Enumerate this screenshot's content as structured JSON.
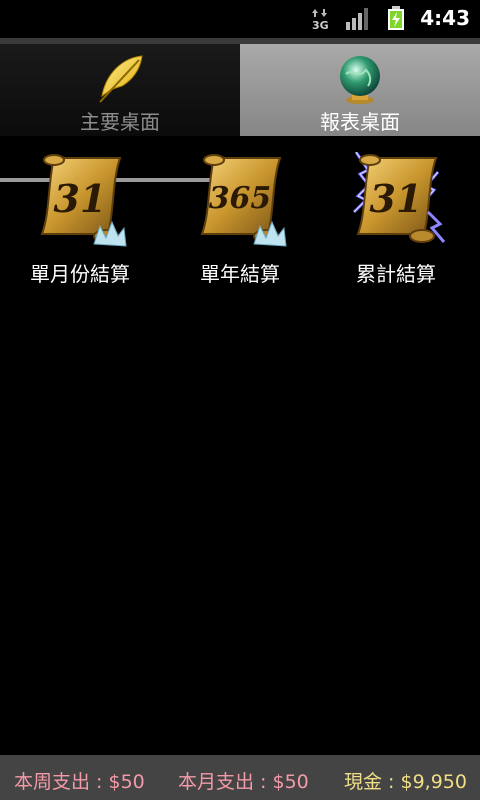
{
  "status_bar": {
    "time": "4:43",
    "icons": [
      "3g-data-icon",
      "signal-icon",
      "battery-charging-icon"
    ]
  },
  "tabs": [
    {
      "label": "主要桌面",
      "icon": "feather-quill-icon",
      "selected": false
    },
    {
      "label": "報表桌面",
      "icon": "crystal-globe-icon",
      "selected": true
    }
  ],
  "reports": [
    {
      "label": "單月份結算",
      "scroll_text": "31",
      "icon": "scroll-31-icon"
    },
    {
      "label": "單年結算",
      "scroll_text": "365",
      "icon": "scroll-365-icon"
    },
    {
      "label": "累計結算",
      "scroll_text": "31",
      "icon": "scroll-31-lightning-icon"
    }
  ],
  "summary": {
    "week_spend": "本周支出 : $50",
    "month_spend": "本月支出 : $50",
    "cash": "現金 : $9,950"
  },
  "colors": {
    "spend_text": "#f39aa8",
    "cash_text": "#f0df86",
    "scroll_gold": "#c9962e"
  }
}
